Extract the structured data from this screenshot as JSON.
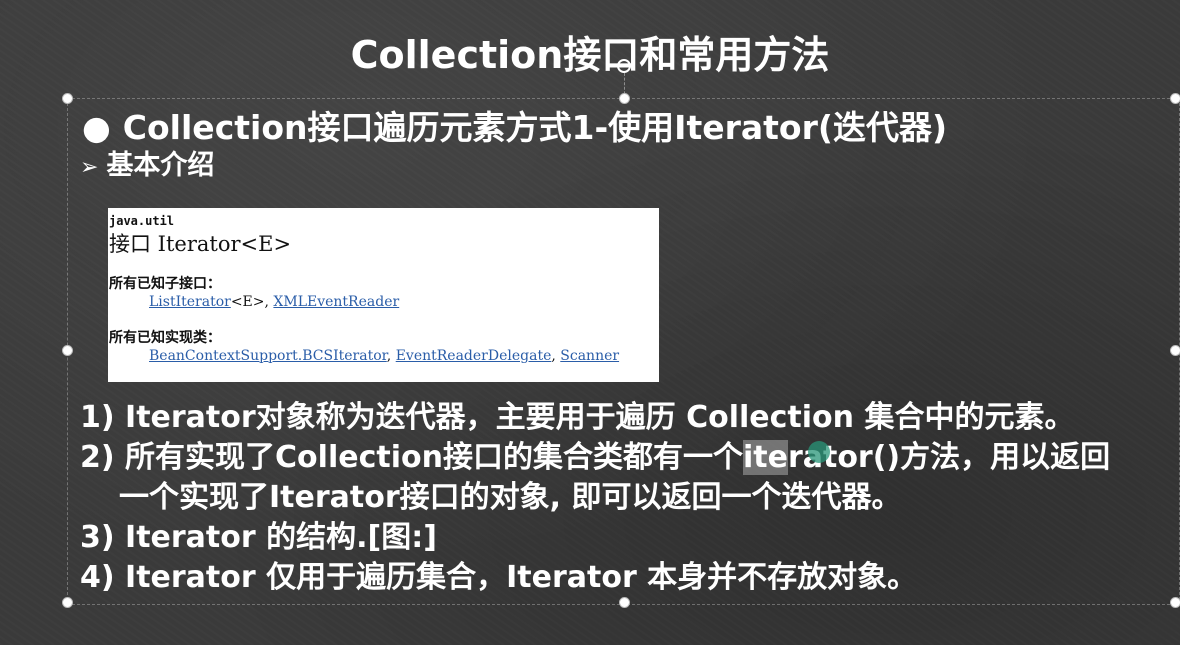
{
  "slide": {
    "title": "Collection接口和常用方法",
    "heading": "Collection接口遍历元素方式1-使用Iterator(迭代器)",
    "heading_bullet": "●",
    "subheading_arrow": "➢",
    "subheading": "基本介绍"
  },
  "doc_panel": {
    "package": "java.util",
    "interface_title": "接口 Iterator<E>",
    "subinterfaces_label": "所有已知子接口：",
    "subinterfaces": [
      {
        "name": "ListIterator",
        "suffix": "<E>, "
      },
      {
        "name": "XMLEventReader",
        "suffix": ""
      }
    ],
    "implementing_label": "所有已知实现类：",
    "implementing": [
      {
        "name": "BeanContextSupport.BCSIterator",
        "suffix": ", "
      },
      {
        "name": "EventReaderDelegate",
        "suffix": ", "
      },
      {
        "name": "Scanner",
        "suffix": ""
      }
    ]
  },
  "points": {
    "p1": "1) Iterator对象称为迭代器，主要用于遍历 Collection 集合中的元素。",
    "p2_before": "2) 所有实现了Collection接口的集合类都有一个",
    "p2_highlight": "ite",
    "p2_after": "rator()方法，用以返回",
    "p2_cont": "一个实现了Iterator接口的对象, 即可以返回一个迭代器。",
    "p3": "3) Iterator 的结构.[图:]",
    "p4": "4) Iterator 仅用于遍历集合，Iterator 本身并不存放对象。"
  }
}
